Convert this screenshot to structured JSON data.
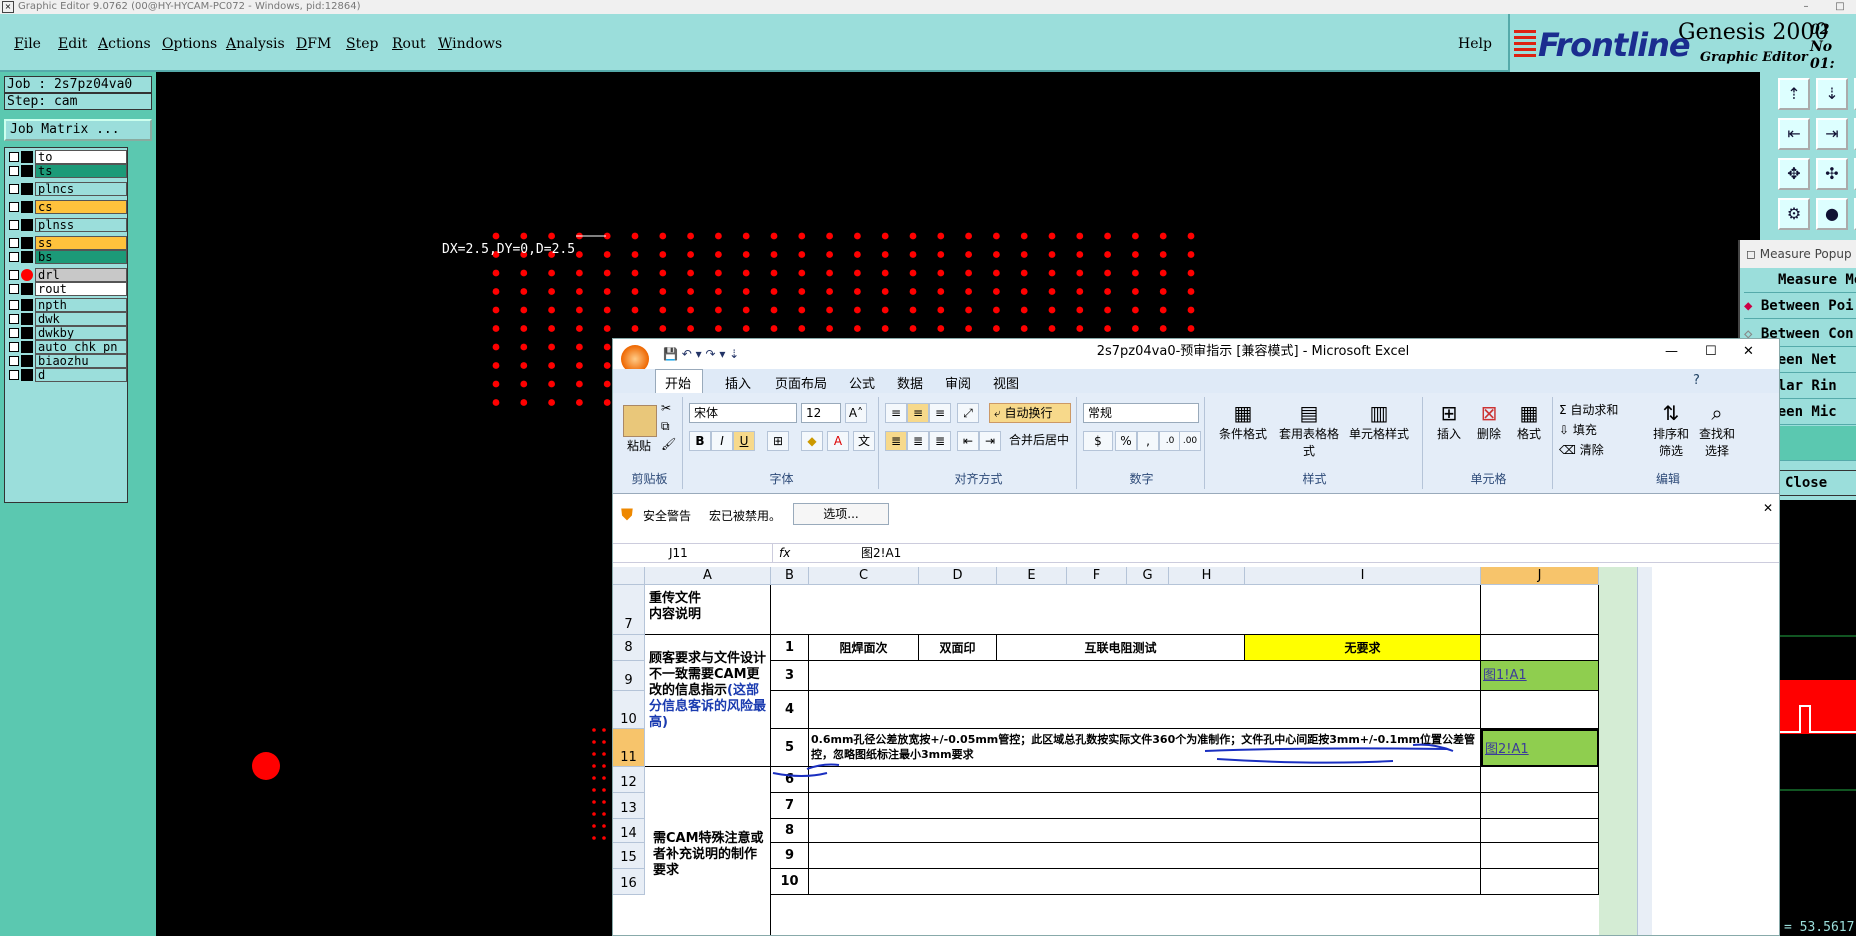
{
  "titlebar": {
    "text": "Graphic Editor 9.0762 (00@HY-HYCAM-PC072 - Windows, pid:12864)",
    "app_icon": "x-box-icon"
  },
  "menu": [
    "File",
    "Edit",
    "Actions",
    "Options",
    "Analysis",
    "DFM",
    "Step",
    "Rout",
    "Windows"
  ],
  "help": "Help",
  "logo": {
    "brand": "Frontline",
    "product": "Genesis 2000",
    "subtitle": "Graphic Editor",
    "clock_line1": "02 No",
    "clock_line2": "01:"
  },
  "job": {
    "job_label": "Job : 2s7pz04va0",
    "step_label": "Step: cam",
    "matrix_button": "Job Matrix ..."
  },
  "layers": [
    {
      "name": "to",
      "color": "#ffffff",
      "swatch": "#000000"
    },
    {
      "name": "ts",
      "color": "#1c9a78",
      "swatch": "#000000"
    },
    {
      "name": "plncs",
      "color": "#9bdedb",
      "swatch": "#000000"
    },
    {
      "name": "cs",
      "color": "#ffc23c",
      "swatch": "#000000"
    },
    {
      "name": "plnss",
      "color": "#9bdedb",
      "swatch": "#000000"
    },
    {
      "name": "ss",
      "color": "#ffc23c",
      "swatch": "#000000"
    },
    {
      "name": "bs",
      "color": "#1c9a78",
      "swatch": "#000000"
    },
    {
      "name": "drl",
      "color": "#c8c8c8",
      "swatch": "#ff0000"
    },
    {
      "name": "rout",
      "color": "#ffffff",
      "swatch": "#000000"
    },
    {
      "name": "npth",
      "color": "#9bdedb",
      "swatch": "#000000"
    },
    {
      "name": "dwk",
      "color": "#9bdedb",
      "swatch": "#000000"
    },
    {
      "name": "dwkby",
      "color": "#9bdedb",
      "swatch": "#000000"
    },
    {
      "name": "auto_chk_pn",
      "color": "#9bdedb",
      "swatch": "#000000"
    },
    {
      "name": "biaozhu",
      "color": "#9bdedb",
      "swatch": "#000000"
    },
    {
      "name": "d",
      "color": "#9bdedb",
      "swatch": "#000000"
    }
  ],
  "canvas": {
    "measure_text": "DX=2.5,DY=0,D=2.5",
    "hole_color": "#ff0000"
  },
  "measure_popup": {
    "title": "Measure Popup",
    "items": [
      "Measure Mo",
      "Between Poi",
      "Between Con",
      "Between Net",
      "Annular Rin",
      "Between Mic",
      ""
    ],
    "close": "Close"
  },
  "coord_readout": "= 53.5617",
  "excel": {
    "title": "2s7pz04va0-预审指示 [兼容模式] - Microsoft Excel",
    "tabs": [
      "开始",
      "插入",
      "页面布局",
      "公式",
      "数据",
      "审阅",
      "视图"
    ],
    "active_tab": "开始",
    "clipboard": {
      "paste": "粘贴",
      "label": "剪贴板"
    },
    "font": {
      "name": "宋体",
      "size": "12",
      "label": "字体",
      "bold": "B",
      "italic": "I",
      "underline": "U"
    },
    "align": {
      "wrap": "自动换行",
      "merge": "合并后居中",
      "label": "对齐方式"
    },
    "number": {
      "format": "常规",
      "percent": "%",
      "comma": ",",
      "label": "数字"
    },
    "styles": {
      "cond": "条件格式",
      "table": "套用表格格式",
      "cell": "单元格样式",
      "label": "样式"
    },
    "cells": {
      "insert": "插入",
      "delete": "删除",
      "format": "格式",
      "label": "单元格"
    },
    "edit": {
      "autosum": "自动求和",
      "fill": "填充",
      "clear": "清除",
      "sort": "排序和筛选",
      "find": "查找和选择",
      "label": "编辑"
    },
    "security": {
      "title": "安全警告",
      "msg": "宏已被禁用。",
      "button": "选项..."
    },
    "namebox": "J11",
    "fx": "fx",
    "formula": "图2!A1",
    "columns": [
      "A",
      "B",
      "C",
      "D",
      "E",
      "F",
      "G",
      "H",
      "I",
      "J"
    ],
    "rows": {
      "r7": {
        "num": "7",
        "a": "重传文件\n内容说明"
      },
      "r8": {
        "num": "8",
        "b": "1",
        "c": "阻焊面次",
        "d": "双面印",
        "e": "互联电阻测试",
        "i": "无要求"
      },
      "r9": {
        "num": "9",
        "b": "3",
        "j": "图1!A1"
      },
      "r10": {
        "num": "10",
        "b": "4"
      },
      "r11": {
        "num": "11",
        "b": "5",
        "c": "0.6mm孔径公差放宽按+/-0.05mm管控；此区域总孔数按实际文件360个为准制作；文件孔中心间距按3mm+/-0.1mm位置公差管控，忽略图纸标注最小3mm要求",
        "j": "图2!A1"
      },
      "r12": {
        "num": "12",
        "b": "6"
      },
      "r13": {
        "num": "13",
        "b": "7"
      },
      "r14": {
        "num": "14",
        "b": "8"
      },
      "r15": {
        "num": "15",
        "b": "9"
      },
      "r16": {
        "num": "16",
        "b": "10"
      }
    },
    "merged_a8": "顾客要求与文件设计不一致需要CAM更改的信息指示",
    "merged_a8_note": "(这部分信息客诉的风险最高)",
    "merged_a12": "需CAM特殊注意或者补充说明的制作要求"
  }
}
